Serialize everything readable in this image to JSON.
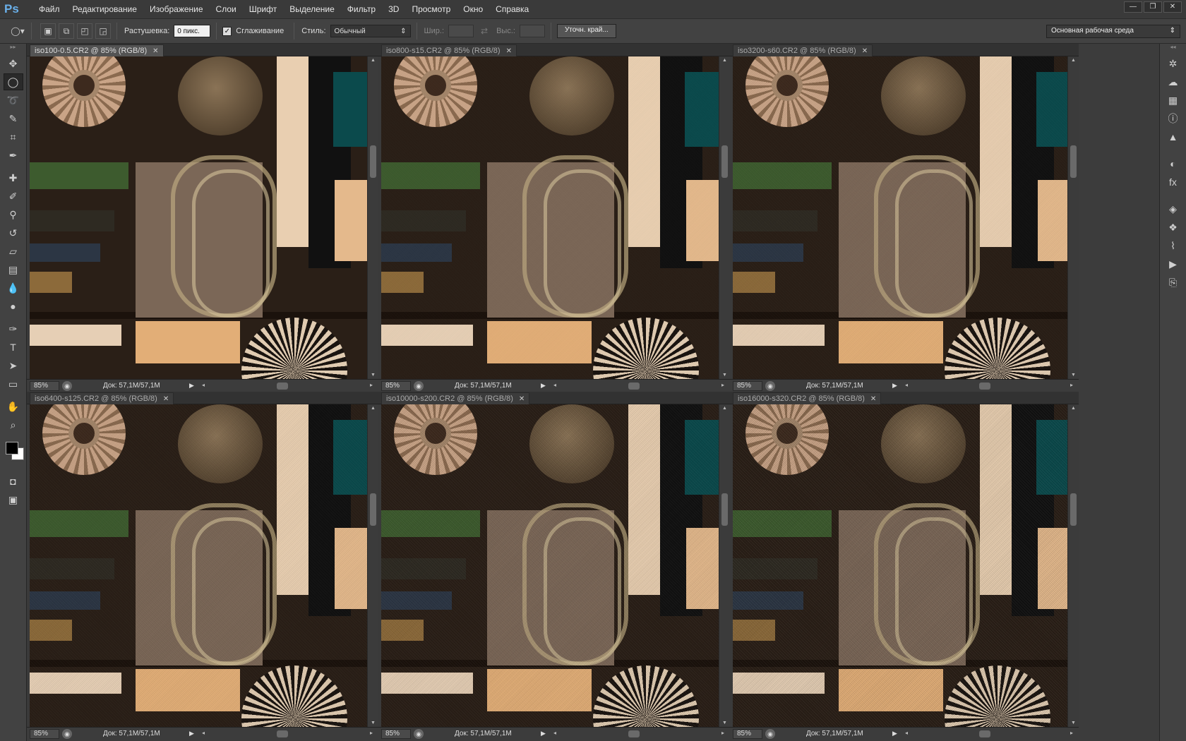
{
  "app": {
    "logo": "Ps"
  },
  "menu": [
    "Файл",
    "Редактирование",
    "Изображение",
    "Слои",
    "Шрифт",
    "Выделение",
    "Фильтр",
    "3D",
    "Просмотр",
    "Окно",
    "Справка"
  ],
  "window_controls": [
    "—",
    "❐",
    "✕"
  ],
  "options": {
    "feather_label": "Растушевка:",
    "feather_value": "0 пикс.",
    "antialias_label": "Сглаживание",
    "style_label": "Стиль:",
    "style_value": "Обычный",
    "width_label": "Шир.:",
    "height_label": "Выс.:",
    "refine_label": "Уточн. край...",
    "workspace": "Основная рабочая среда"
  },
  "documents": [
    {
      "tab": "iso100-0.5.CR2 @ 85% (RGB/8)",
      "zoom": "85%",
      "doc": "Док: 57,1M/57,1M",
      "active": true,
      "noise": 0.0
    },
    {
      "tab": "iso800-s15.CR2 @ 85% (RGB/8)",
      "zoom": "85%",
      "doc": "Док: 57,1M/57,1M",
      "active": false,
      "noise": 0.1
    },
    {
      "tab": "iso3200-s60.CR2 @ 85% (RGB/8)",
      "zoom": "85%",
      "doc": "Док: 57,1M/57,1M",
      "active": false,
      "noise": 0.2
    },
    {
      "tab": "iso6400-s125.CR2 @ 85% (RGB/8)",
      "zoom": "85%",
      "doc": "Док: 57,1M/57,1M",
      "active": false,
      "noise": 0.3
    },
    {
      "tab": "iso10000-s200.CR2 @ 85% (RGB/8)",
      "zoom": "85%",
      "doc": "Док: 57,1M/57,1M",
      "active": false,
      "noise": 0.45
    },
    {
      "tab": "iso16000-s320.CR2 @ 85% (RGB/8)",
      "zoom": "85%",
      "doc": "Док: 57,1M/57,1M",
      "active": false,
      "noise": 0.6
    }
  ],
  "tools": [
    {
      "name": "move-tool-icon",
      "glyph": "✥"
    },
    {
      "name": "elliptical-marquee-icon",
      "glyph": "◯"
    },
    {
      "name": "lasso-icon",
      "glyph": "➰"
    },
    {
      "name": "quick-selection-icon",
      "glyph": "✎"
    },
    {
      "name": "crop-icon",
      "glyph": "⌗"
    },
    {
      "name": "eyedropper-icon",
      "glyph": "✒"
    },
    {
      "name": "healing-brush-icon",
      "glyph": "✚"
    },
    {
      "name": "brush-icon",
      "glyph": "✐"
    },
    {
      "name": "clone-stamp-icon",
      "glyph": "⚲"
    },
    {
      "name": "history-brush-icon",
      "glyph": "↺"
    },
    {
      "name": "eraser-icon",
      "glyph": "▱"
    },
    {
      "name": "gradient-icon",
      "glyph": "▤"
    },
    {
      "name": "blur-icon",
      "glyph": "💧"
    },
    {
      "name": "dodge-icon",
      "glyph": "●"
    },
    {
      "name": "pen-icon",
      "glyph": "✑"
    },
    {
      "name": "type-icon",
      "glyph": "T"
    },
    {
      "name": "path-selection-icon",
      "glyph": "➤"
    },
    {
      "name": "rectangle-shape-icon",
      "glyph": "▭"
    },
    {
      "name": "hand-icon",
      "glyph": "✋"
    },
    {
      "name": "zoom-icon",
      "glyph": "⌕"
    }
  ],
  "right_panel": [
    {
      "name": "navigator-icon",
      "glyph": "✲"
    },
    {
      "name": "color-icon",
      "glyph": "☁"
    },
    {
      "name": "swatches-icon",
      "glyph": "▦"
    },
    {
      "name": "info-icon",
      "glyph": "ⓘ"
    },
    {
      "name": "histogram-icon",
      "glyph": "▲"
    },
    {
      "name": "gap",
      "glyph": ""
    },
    {
      "name": "adjustments-icon",
      "glyph": "◐"
    },
    {
      "name": "styles-icon",
      "glyph": "fx"
    },
    {
      "name": "gap",
      "glyph": ""
    },
    {
      "name": "layers-icon",
      "glyph": "◈"
    },
    {
      "name": "channels-icon",
      "glyph": "❖"
    },
    {
      "name": "paths-icon",
      "glyph": "⌇"
    },
    {
      "name": "actions-icon",
      "glyph": "▶"
    },
    {
      "name": "history-icon",
      "glyph": "⎘"
    }
  ]
}
